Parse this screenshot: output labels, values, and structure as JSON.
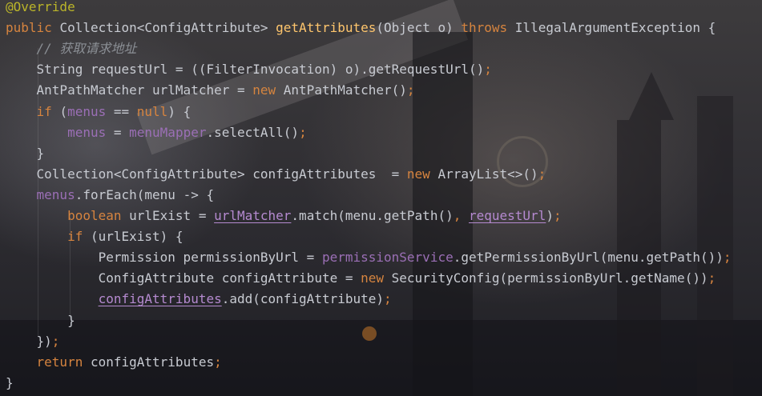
{
  "editor": {
    "language": "java",
    "lines": [
      [
        {
          "t": "@Override",
          "c": "ann"
        }
      ],
      [
        {
          "t": "public ",
          "c": "kw"
        },
        {
          "t": "Collection<ConfigAttribute> ",
          "c": "pl"
        },
        {
          "t": "getAttributes",
          "c": "fn"
        },
        {
          "t": "(Object o) ",
          "c": "pl"
        },
        {
          "t": "throws ",
          "c": "kw"
        },
        {
          "t": "IllegalArgumentException {",
          "c": "pl"
        }
      ],
      [
        {
          "t": "    // 获取请求地址",
          "c": "cmt"
        }
      ],
      [
        {
          "t": "    String requestUrl = ((FilterInvocation) o).getRequestUrl()",
          "c": "pl"
        },
        {
          "t": ";",
          "c": "kw"
        }
      ],
      [
        {
          "t": "    AntPathMatcher urlMatcher = ",
          "c": "pl"
        },
        {
          "t": "new ",
          "c": "kw"
        },
        {
          "t": "AntPathMatcher()",
          "c": "pl"
        },
        {
          "t": ";",
          "c": "kw"
        }
      ],
      [
        {
          "t": "    ",
          "c": "pl"
        },
        {
          "t": "if ",
          "c": "kw"
        },
        {
          "t": "(",
          "c": "pl"
        },
        {
          "t": "menus",
          "c": "fld"
        },
        {
          "t": " == ",
          "c": "pl"
        },
        {
          "t": "null",
          "c": "kw"
        },
        {
          "t": ") {",
          "c": "pl"
        }
      ],
      [
        {
          "t": "        ",
          "c": "pl"
        },
        {
          "t": "menus",
          "c": "fld"
        },
        {
          "t": " = ",
          "c": "pl"
        },
        {
          "t": "menuMapper",
          "c": "fld"
        },
        {
          "t": ".selectAll()",
          "c": "pl"
        },
        {
          "t": ";",
          "c": "kw"
        }
      ],
      [
        {
          "t": "    }",
          "c": "pl"
        }
      ],
      [
        {
          "t": "    Collection<ConfigAttribute> configAttributes  = ",
          "c": "pl"
        },
        {
          "t": "new ",
          "c": "kw"
        },
        {
          "t": "ArrayList<>()",
          "c": "pl"
        },
        {
          "t": ";",
          "c": "kw"
        }
      ],
      [
        {
          "t": "    ",
          "c": "pl"
        },
        {
          "t": "menus",
          "c": "fld"
        },
        {
          "t": ".forEach(menu -> {",
          "c": "pl"
        }
      ],
      [
        {
          "t": "        ",
          "c": "pl"
        },
        {
          "t": "boolean ",
          "c": "kw"
        },
        {
          "t": "urlExist = ",
          "c": "pl"
        },
        {
          "t": "urlMatcher",
          "c": "var-ul"
        },
        {
          "t": ".match(menu.getPath()",
          "c": "pl"
        },
        {
          "t": ", ",
          "c": "kw"
        },
        {
          "t": "requestUrl",
          "c": "var-ul"
        },
        {
          "t": ")",
          "c": "pl"
        },
        {
          "t": ";",
          "c": "kw"
        }
      ],
      [
        {
          "t": "        ",
          "c": "pl"
        },
        {
          "t": "if ",
          "c": "kw"
        },
        {
          "t": "(urlExist) {",
          "c": "pl"
        }
      ],
      [
        {
          "t": "            Permission permissionByUrl = ",
          "c": "pl"
        },
        {
          "t": "permissionService",
          "c": "fld"
        },
        {
          "t": ".getPermissionByUrl(menu.getPath())",
          "c": "pl"
        },
        {
          "t": ";",
          "c": "kw"
        }
      ],
      [
        {
          "t": "            ConfigAttribute configAttribute = ",
          "c": "pl"
        },
        {
          "t": "new ",
          "c": "kw"
        },
        {
          "t": "SecurityConfig(permissionByUrl.getName())",
          "c": "pl"
        },
        {
          "t": ";",
          "c": "kw"
        }
      ],
      [
        {
          "t": "            ",
          "c": "pl"
        },
        {
          "t": "configAttributes",
          "c": "var-ul"
        },
        {
          "t": ".add(configAttribute)",
          "c": "pl"
        },
        {
          "t": ";",
          "c": "kw"
        }
      ],
      [
        {
          "t": "        }",
          "c": "pl"
        }
      ],
      [
        {
          "t": "    })",
          "c": "pl"
        },
        {
          "t": ";",
          "c": "kw"
        }
      ],
      [
        {
          "t": "    ",
          "c": "pl"
        },
        {
          "t": "return ",
          "c": "kw"
        },
        {
          "t": "configAttributes",
          "c": "pl"
        },
        {
          "t": ";",
          "c": "kw"
        }
      ],
      [
        {
          "t": "}",
          "c": "pl"
        }
      ]
    ]
  }
}
